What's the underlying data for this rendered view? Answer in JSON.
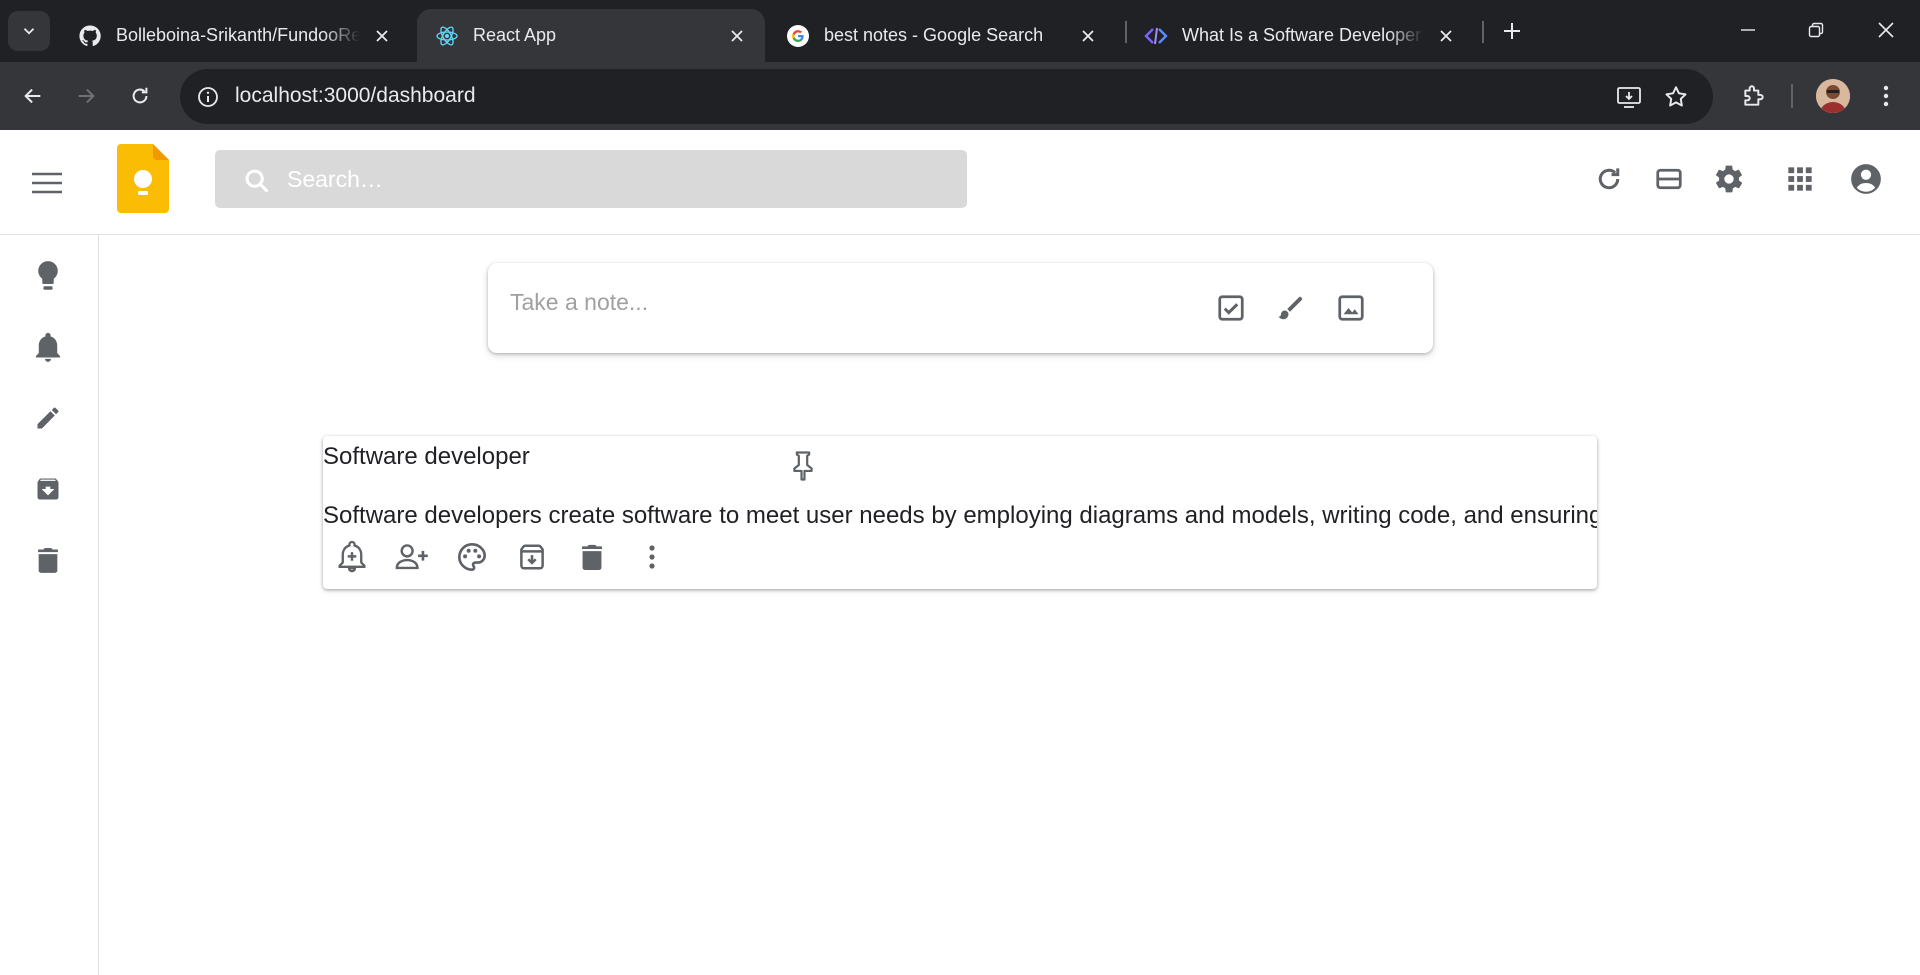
{
  "browser": {
    "tabs": [
      {
        "title": "Bolleboina-Srikanth/FundooRea",
        "favicon": "github-icon",
        "active": false
      },
      {
        "title": "React App",
        "favicon": "react-icon",
        "active": true
      },
      {
        "title": "best notes - Google Search",
        "favicon": "google-icon",
        "active": false
      },
      {
        "title": "What Is a Software Developer? |",
        "favicon": "site-icon",
        "active": false
      }
    ],
    "url": "localhost:3000/dashboard"
  },
  "header": {
    "logo": "keep-logo-icon",
    "search_placeholder": "Search…",
    "icons": [
      "refresh-icon",
      "list-view-icon",
      "settings-icon",
      "apps-grid-icon",
      "account-icon"
    ]
  },
  "sidebar": {
    "items": [
      {
        "icon": "lightbulb-icon",
        "name": "notes"
      },
      {
        "icon": "bell-icon",
        "name": "reminders"
      },
      {
        "icon": "pencil-icon",
        "name": "edit-labels"
      },
      {
        "icon": "archive-icon",
        "name": "archive"
      },
      {
        "icon": "trash-icon",
        "name": "trash"
      }
    ]
  },
  "take_note": {
    "placeholder": "Take a note...",
    "icons": [
      "checkbox-icon",
      "brush-icon",
      "image-icon"
    ]
  },
  "notes": [
    {
      "title": "Software developer",
      "body": "Software developers create software to meet user needs by employing diagrams and models, writing code, and ensuring",
      "pinned": false,
      "actions": [
        "add-reminder-icon",
        "collaborator-icon",
        "palette-icon",
        "archive-icon",
        "delete-icon",
        "more-icon"
      ]
    }
  ],
  "colors": {
    "chrome_dark": "#202124",
    "chrome_tab": "#35363a",
    "keep_yellow": "#fbbc04",
    "icon_gray": "#5f6368"
  }
}
